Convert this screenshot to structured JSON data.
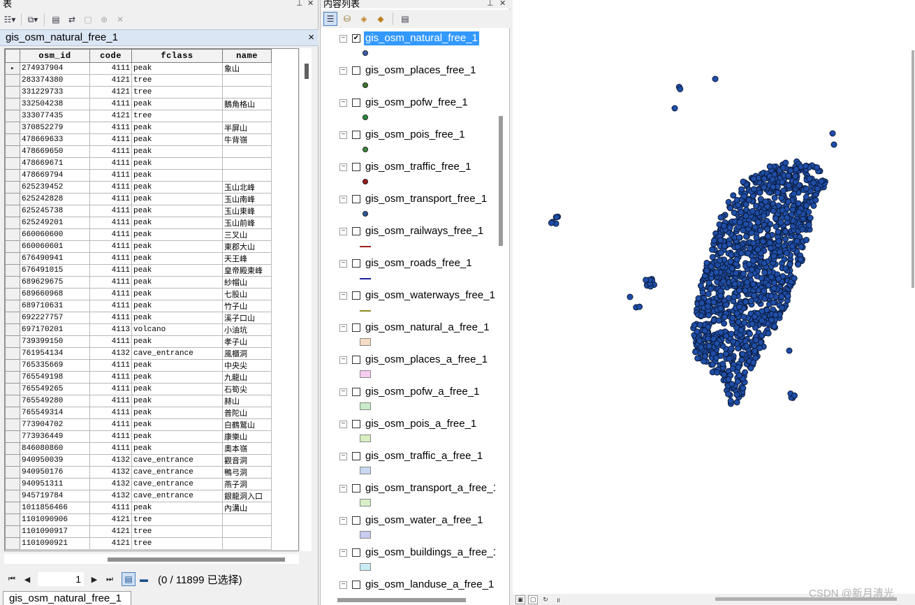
{
  "table_panel": {
    "title": "表",
    "tab_title": "gis_osm_natural_free_1",
    "close_label": "×",
    "columns": [
      "osm_id",
      "code",
      "fclass",
      "name"
    ],
    "rows": [
      [
        "274937904",
        "4111",
        "peak",
        "象山"
      ],
      [
        "283374380",
        "4121",
        "tree",
        ""
      ],
      [
        "331229733",
        "4121",
        "tree",
        ""
      ],
      [
        "332504238",
        "4111",
        "peak",
        "鵝角格山"
      ],
      [
        "333077435",
        "4121",
        "tree",
        ""
      ],
      [
        "370852279",
        "4111",
        "peak",
        "半屏山"
      ],
      [
        "478669633",
        "4111",
        "peak",
        "牛背嶺"
      ],
      [
        "478669650",
        "4111",
        "peak",
        ""
      ],
      [
        "478669671",
        "4111",
        "peak",
        ""
      ],
      [
        "478669794",
        "4111",
        "peak",
        ""
      ],
      [
        "625239452",
        "4111",
        "peak",
        "玉山北峰"
      ],
      [
        "625242828",
        "4111",
        "peak",
        "玉山南峰"
      ],
      [
        "625245738",
        "4111",
        "peak",
        "玉山東峰"
      ],
      [
        "625249201",
        "4111",
        "peak",
        "玉山前峰"
      ],
      [
        "660060600",
        "4111",
        "peak",
        "三叉山"
      ],
      [
        "660060601",
        "4111",
        "peak",
        "東郡大山"
      ],
      [
        "676490941",
        "4111",
        "peak",
        "天王峰"
      ],
      [
        "676491015",
        "4111",
        "peak",
        "皇帝殿東峰"
      ],
      [
        "689629675",
        "4111",
        "peak",
        "紗帽山"
      ],
      [
        "689660968",
        "4111",
        "peak",
        "七股山"
      ],
      [
        "689710631",
        "4111",
        "peak",
        "竹子山"
      ],
      [
        "692227757",
        "4111",
        "peak",
        "溪子口山"
      ],
      [
        "697170201",
        "4113",
        "volcano",
        "小油坑"
      ],
      [
        "739399150",
        "4111",
        "peak",
        "孝子山"
      ],
      [
        "761954134",
        "4132",
        "cave_entrance",
        "風櫃洞"
      ],
      [
        "765335669",
        "4111",
        "peak",
        "中央尖"
      ],
      [
        "765549198",
        "4111",
        "peak",
        "九龍山"
      ],
      [
        "765549265",
        "4111",
        "peak",
        "石筍尖"
      ],
      [
        "765549280",
        "4111",
        "peak",
        "赫山"
      ],
      [
        "765549314",
        "4111",
        "peak",
        "普陀山"
      ],
      [
        "773904702",
        "4111",
        "peak",
        "白鶴鷲山"
      ],
      [
        "773936449",
        "4111",
        "peak",
        "康樂山"
      ],
      [
        "846080860",
        "4111",
        "peak",
        "奧本嶺"
      ],
      [
        "940950039",
        "4132",
        "cave_entrance",
        "觀音洞"
      ],
      [
        "940950176",
        "4132",
        "cave_entrance",
        "鴨弓洞"
      ],
      [
        "940951311",
        "4132",
        "cave_entrance",
        "燕子洞"
      ],
      [
        "945719784",
        "4132",
        "cave_entrance",
        "銀龍洞入口"
      ],
      [
        "1011856466",
        "4111",
        "peak",
        "內溝山"
      ],
      [
        "1101090906",
        "4121",
        "tree",
        ""
      ],
      [
        "1101090917",
        "4121",
        "tree",
        ""
      ],
      [
        "1101090921",
        "4121",
        "tree",
        ""
      ]
    ],
    "record_number": "1",
    "selection_status": "(0 / 11899 已选择)",
    "bottom_tab": "gis_osm_natural_free_1"
  },
  "toc_panel": {
    "title": "内容列表",
    "layers": [
      {
        "name": "gis_osm_natural_free_1",
        "checked": true,
        "highlight": true,
        "symbol": "point",
        "color": "#3a5fb0"
      },
      {
        "name": "gis_osm_places_free_1",
        "checked": false,
        "symbol": "point",
        "color": "#3a7a2a"
      },
      {
        "name": "gis_osm_pofw_free_1",
        "checked": false,
        "symbol": "point",
        "color": "#2a8a3a"
      },
      {
        "name": "gis_osm_pois_free_1",
        "checked": false,
        "symbol": "point",
        "color": "#3a8a3a"
      },
      {
        "name": "gis_osm_traffic_free_1",
        "checked": false,
        "symbol": "point",
        "color": "#a01818"
      },
      {
        "name": "gis_osm_transport_free_1",
        "checked": false,
        "symbol": "point",
        "color": "#2a5a9a"
      },
      {
        "name": "gis_osm_railways_free_1",
        "checked": false,
        "symbol": "line",
        "color": "#a02020"
      },
      {
        "name": "gis_osm_roads_free_1",
        "checked": false,
        "symbol": "line",
        "color": "#2020a0"
      },
      {
        "name": "gis_osm_waterways_free_1",
        "checked": false,
        "symbol": "line",
        "color": "#8a8a20"
      },
      {
        "name": "gis_osm_natural_a_free_1",
        "checked": false,
        "symbol": "polygon",
        "color": "#f6dcc4"
      },
      {
        "name": "gis_osm_places_a_free_1",
        "checked": false,
        "symbol": "polygon",
        "color": "#f6cdf0"
      },
      {
        "name": "gis_osm_pofw_a_free_1",
        "checked": false,
        "symbol": "polygon",
        "color": "#c8ecc8"
      },
      {
        "name": "gis_osm_pois_a_free_1",
        "checked": false,
        "symbol": "polygon",
        "color": "#d8f0c0"
      },
      {
        "name": "gis_osm_traffic_a_free_1",
        "checked": false,
        "symbol": "polygon",
        "color": "#c8d8f0"
      },
      {
        "name": "gis_osm_transport_a_free_1",
        "checked": false,
        "symbol": "polygon",
        "color": "#d8f0c8"
      },
      {
        "name": "gis_osm_water_a_free_1",
        "checked": false,
        "symbol": "polygon",
        "color": "#c8ccf0"
      },
      {
        "name": "gis_osm_buildings_a_free_1",
        "checked": false,
        "symbol": "polygon",
        "color": "#c8ecf6"
      },
      {
        "name": "gis_osm_landuse_a_free_1",
        "checked": false,
        "symbol": "polygon",
        "color": "#f0e0d0"
      }
    ]
  },
  "map": {
    "point_color": "#1f4ea8",
    "outline_color": "#0a1a3a"
  },
  "watermark": "CSDN @新月清光"
}
